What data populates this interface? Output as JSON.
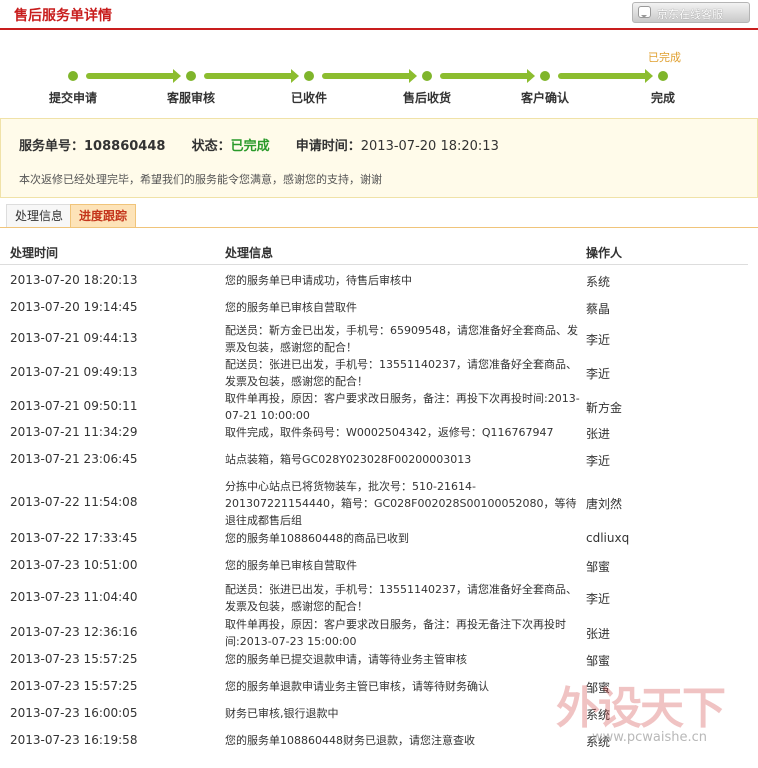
{
  "header": {
    "title": "售后服务单详情",
    "service_button": "京东在线客服"
  },
  "progress": {
    "status_text": "已完成",
    "steps": [
      "提交申请",
      "客服审核",
      "已收件",
      "售后收货",
      "客户确认",
      "完成"
    ]
  },
  "summary": {
    "order_label": "服务单号：",
    "order_no": "108860448",
    "status_label": "状态：",
    "status": "已完成",
    "time_label": "申请时间：",
    "time": "2013-07-20 18:20:13",
    "message": "本次返修已经处理完毕，希望我们的服务能令您满意，感谢您的支持，谢谢"
  },
  "tabs": [
    "处理信息",
    "进度跟踪"
  ],
  "table": {
    "headers": [
      "处理时间",
      "处理信息",
      "操作人"
    ],
    "rows": [
      {
        "time": "2013-07-20 18:20:13",
        "info": "您的服务单已申请成功，待售后审核中",
        "op": "系统"
      },
      {
        "time": "2013-07-20 19:14:45",
        "info": "您的服务单已审核自营取件",
        "op": "蔡晶"
      },
      {
        "time": "2013-07-21 09:44:13",
        "info": "配送员：靳方金已出发，手机号：65909548，请您准备好全套商品、发票及包装，感谢您的配合！",
        "op": "李近"
      },
      {
        "time": "2013-07-21 09:49:13",
        "info": "配送员：张进已出发，手机号：13551140237，请您准备好全套商品、发票及包装，感谢您的配合！",
        "op": "李近"
      },
      {
        "time": "2013-07-21 09:50:11",
        "info": "取件单再投，原因：客户要求改日服务，备注：再投下次再投时间:2013-07-21 10:00:00",
        "op": "靳方金"
      },
      {
        "time": "2013-07-21 11:34:29",
        "info": "取件完成，取件条码号：W0002504342，返修号：Q116767947",
        "op": "张进"
      },
      {
        "time": "2013-07-21 23:06:45",
        "info": "站点装箱，箱号GC028Y023028F00200003013",
        "op": "李近"
      },
      {
        "time": "2013-07-22 11:54:08",
        "info": "分拣中心站点已将货物装车，批次号：510-21614-201307221154440，箱号：GC028F002028S00100052080，等待退往成都售后组",
        "op": "唐刘然"
      },
      {
        "time": "2013-07-22 17:33:45",
        "info": "您的服务单108860448的商品已收到",
        "op": "cdliuxq"
      },
      {
        "time": "2013-07-23 10:51:00",
        "info": "您的服务单已审核自营取件",
        "op": "邹蜜"
      },
      {
        "time": "2013-07-23 11:04:40",
        "info": "配送员：张进已出发，手机号：13551140237，请您准备好全套商品、发票及包装，感谢您的配合！",
        "op": "李近"
      },
      {
        "time": "2013-07-23 12:36:16",
        "info": "取件单再投，原因：客户要求改日服务，备注：再投无备注下次再投时间:2013-07-23 15:00:00",
        "op": "张进"
      },
      {
        "time": "2013-07-23 15:57:25",
        "info": "您的服务单已提交退款申请，请等待业务主管审核",
        "op": "邹蜜"
      },
      {
        "time": "2013-07-23 15:57:25",
        "info": "您的服务单退款申请业务主管已审核，请等待财务确认",
        "op": "邹蜜"
      },
      {
        "time": "2013-07-23 16:00:05",
        "info": "财务已审核,银行退款中",
        "op": "系统"
      },
      {
        "time": "2013-07-23 16:19:58",
        "info": "您的服务单108860448财务已退款，请您注意查收",
        "op": "系统"
      }
    ]
  },
  "watermark": {
    "big": "外设天下",
    "small": "www.pcwaishe.cn"
  }
}
